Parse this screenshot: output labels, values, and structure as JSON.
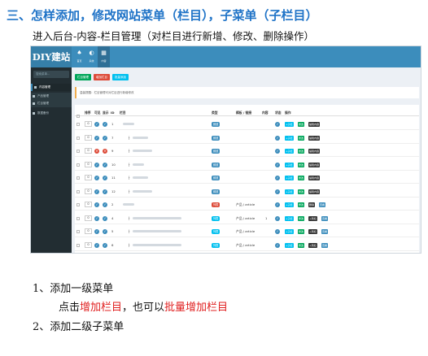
{
  "heading": "三、怎样添加，修改网站菜单（栏目），子菜单（子栏目）",
  "intro": "进入后台-内容-栏目管理（对栏目进行新增、修改、删除操作）",
  "screenshot": {
    "brand": "DIY建站",
    "top_nav": [
      {
        "glyph": "♠",
        "label": "首页"
      },
      {
        "glyph": "◐",
        "label": "系统"
      },
      {
        "glyph": "▦",
        "label": "内容"
      }
    ],
    "sidebar": {
      "search_placeholder": "搜索菜单...",
      "items": [
        "内容管理",
        "产品管理",
        "栏目管理",
        "数据备份"
      ]
    },
    "toolbar": [
      {
        "label": "栏目管理",
        "color": "#00a65a"
      },
      {
        "label": "增加栏目",
        "color": "#dd4b39"
      },
      {
        "label": "批量添加",
        "color": "#00c0ef"
      }
    ],
    "tip": "温馨提醒：栏目管理可对栏目进行新增修改",
    "columns": [
      "排序",
      "可见",
      "显示",
      "ID",
      "栏目",
      "类型",
      "模板 / 链接",
      "内容",
      "状态",
      "操作"
    ],
    "rows": [
      {
        "sort": "0",
        "vis": "ok",
        "show": "ok",
        "id": "1",
        "indent": 0,
        "type": "频道",
        "type_color": "#3c8dbc",
        "tpl": "",
        "cnt": "",
        "level": 1
      },
      {
        "sort": "0",
        "vis": "ok",
        "show": "ok",
        "id": "7",
        "indent": 1,
        "type": "频道",
        "type_color": "#3c8dbc",
        "tpl": "",
        "cnt": "",
        "level": 1
      },
      {
        "sort": "0",
        "vis": "x",
        "show": "x",
        "id": "9",
        "indent": 1,
        "type": "频道",
        "type_color": "#3c8dbc",
        "tpl": "",
        "cnt": "",
        "level": 1
      },
      {
        "sort": "0",
        "vis": "ok",
        "show": "ok",
        "id": "10",
        "indent": 1,
        "type": "频道",
        "type_color": "#3c8dbc",
        "tpl": "",
        "cnt": "",
        "level": 1
      },
      {
        "sort": "0",
        "vis": "ok",
        "show": "ok",
        "id": "11",
        "indent": 1,
        "type": "频道",
        "type_color": "#3c8dbc",
        "tpl": "",
        "cnt": "",
        "level": 1
      },
      {
        "sort": "0",
        "vis": "ok",
        "show": "ok",
        "id": "12",
        "indent": 1,
        "type": "频道",
        "type_color": "#3c8dbc",
        "tpl": "",
        "cnt": "",
        "level": 1
      },
      {
        "sort": "0",
        "vis": "ok",
        "show": "ok",
        "id": "2",
        "indent": 0,
        "type": "列表",
        "type_color": "#dd4b39",
        "tpl": "产品 / article",
        "cnt": "",
        "level": 2
      },
      {
        "sort": "0",
        "vis": "ok",
        "show": "ok",
        "id": "4",
        "indent": 1,
        "type": "列表",
        "type_color": "#00c0ef",
        "tpl": "产品 / article",
        "cnt": "1",
        "level": 3
      },
      {
        "sort": "0",
        "vis": "ok",
        "show": "ok",
        "id": "5",
        "indent": 1,
        "type": "列表",
        "type_color": "#00c0ef",
        "tpl": "产品 / article",
        "cnt": "",
        "level": 3
      },
      {
        "sort": "0",
        "vis": "ok",
        "show": "ok",
        "id": "6",
        "indent": 1,
        "type": "列表",
        "type_color": "#00c0ef",
        "tpl": "产品 / article",
        "cnt": "",
        "level": 3
      }
    ],
    "actions": {
      "add_sub": "+子栏",
      "edit": "修改",
      "del": "删除",
      "edit_cat": "编辑内容",
      "add_content": "+添加",
      "view": "查看"
    },
    "colors": {
      "ok": "#3c8dbc",
      "x": "#dd4b39",
      "green": "#00a65a",
      "dark": "#333333",
      "aqua": "#00c0ef"
    }
  },
  "step1_title": "1、添加一级菜单",
  "step1_detail": {
    "prefix": "点击",
    "link1": "增加栏目",
    "middle": "，也可以",
    "link2": "批量增加栏目"
  },
  "step2_title": "2、添加二级子菜单"
}
